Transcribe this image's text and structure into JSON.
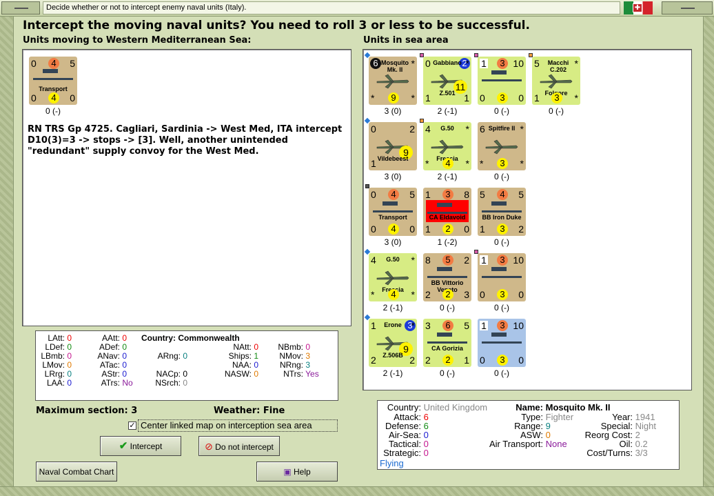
{
  "window": {
    "title": "Decide whether or not to intercept enemy naval units (Italy)."
  },
  "heading": "Intercept the moving naval units?  You need to roll 3 or less to be successful.",
  "left_section": "Units moving to Western Mediterranean Sea:",
  "right_section": "Units in sea area",
  "moving_unit": {
    "tl": "0",
    "tc": "4",
    "tr": "5",
    "name": "Transport",
    "bl": "0",
    "bc": "4",
    "br": "0",
    "label": "0 (-)"
  },
  "narrative": "RN TRS Gp 4725.  Cagliari, Sardinia -> West Med, ITA intercept D10(3)=3 -> stops -> [3].  Well, another unintended \"redundant\" supply convoy for the West Med.",
  "sea_units": [
    {
      "tl": "6",
      "name": "Mosquito Mk. II",
      "tr": "*",
      "bl": "*",
      "bc": "9",
      "br": "*",
      "label": "3 (0)"
    },
    {
      "tl": "0",
      "name": "Gabbiano",
      "tc": "2",
      "tr": "*",
      "mid": "11",
      "bl": "1",
      "bname": "Z.501",
      "br": "1",
      "label": "2 (-1)"
    },
    {
      "tl": "1",
      "tc": "3",
      "tr": "10",
      "bl": "0",
      "bc": "3",
      "br": "0",
      "label": "0 (-)"
    },
    {
      "tl": "5",
      "name": "Macchi C.202",
      "tr": "*",
      "bname": "Folgore",
      "bl": "1",
      "bc": "3",
      "br": "*",
      "label": "0 (-)"
    },
    {
      "tl": "0",
      "tr": "2",
      "mid": "9",
      "bl": "1",
      "bname": "Vildebeest",
      "label": "3 (0)"
    },
    {
      "tl": "4",
      "name": "G.50",
      "tr": "*",
      "bname": "Freccia",
      "bl": "*",
      "bc": "4",
      "br": "*",
      "label": "2 (-1)"
    },
    {
      "tl": "6",
      "name": "Spitfire II",
      "tr": "*",
      "bl": "*",
      "bc": "3",
      "br": "*",
      "label": "0 (-)"
    },
    {
      "tl": "0",
      "tc": "4",
      "tr": "5",
      "name": "Transport",
      "bl": "0",
      "bc": "4",
      "br": "0",
      "label": "3 (0)"
    },
    {
      "tl": "1",
      "tc": "3",
      "tr": "8",
      "name": "CA Eldavoid",
      "bl": "1",
      "bc": "2",
      "br": "0",
      "label": "1 (-2)"
    },
    {
      "tl": "5",
      "tc": "4",
      "tr": "5",
      "name": "BB Iron Duke",
      "bl": "1",
      "bc": "3",
      "br": "2",
      "label": "0 (-)"
    },
    {
      "tl": "4",
      "name": "G.50",
      "tr": "*",
      "bname": "Freccia",
      "bl": "*",
      "bc": "4",
      "br": "*",
      "label": "2 (-1)"
    },
    {
      "tl": "8",
      "tc": "5",
      "tr": "2",
      "name": "BB Vittorio Veneto",
      "bl": "2",
      "bc": "2",
      "br": "3",
      "label": "0 (-)"
    },
    {
      "tl": "1",
      "tc": "3",
      "tr": "10",
      "bl": "0",
      "bc": "3",
      "br": "0",
      "label": "0 (-)"
    },
    {
      "tl": "1",
      "name": "Erone",
      "tc": "3",
      "tr": "*",
      "mid": "9",
      "bl": "2",
      "bname": "Z.506B",
      "br": "2",
      "label": "2 (-1)"
    },
    {
      "tl": "3",
      "tc": "6",
      "tr": "5",
      "name": "CA Gorizia",
      "bl": "2",
      "bc": "2",
      "br": "1",
      "label": "0 (-)"
    },
    {
      "tl": "1",
      "tc": "3",
      "tr": "10",
      "bl": "0",
      "bc": "3",
      "br": "0",
      "label": "0 (-)"
    }
  ],
  "stats": {
    "latt": "0",
    "ldef": "0",
    "lbmb": "0",
    "lmov": "0",
    "lrng": "0",
    "laa": "0",
    "aatt": "0",
    "adef": "0",
    "anav": "0",
    "atac": "0",
    "astr": "0",
    "atrs": "No",
    "country_label": "Country:",
    "country": "Commonwealth",
    "arng": "0",
    "nacp": "0",
    "nsrch": "0",
    "natt": "0",
    "ships": "1",
    "naa": "0",
    "nasw": "0",
    "nbmb": "0",
    "nmov": "3",
    "nrng": "3",
    "ntrs": "Yes"
  },
  "max_section": "Maximum section: 3",
  "weather": "Weather:  Fine",
  "checkbox_label": "Center linked map on interception sea area",
  "checkbox_mark": "✓",
  "buttons": {
    "intercept": "Intercept",
    "no_intercept": "Do not intercept",
    "chart": "Naval Combat Chart",
    "help": "Help"
  },
  "info": {
    "country": "United Kingdom",
    "attack": "6",
    "defense": "6",
    "air_sea": "0",
    "tactical": "0",
    "strategic": "0",
    "flying": "Flying",
    "name": "Mosquito Mk. II",
    "type": "Fighter",
    "range": "9",
    "asw": "0",
    "air_transport": "None",
    "year": "1941",
    "special": "Night",
    "reorg": "2",
    "oil": "0.2",
    "cost_turns": "3/3"
  },
  "colors": {
    "accent_green": "#d7ec84",
    "counter_tan": "#cfb88a",
    "counter_blue": "#a9c4e8",
    "bg": "#d4dfb7"
  }
}
